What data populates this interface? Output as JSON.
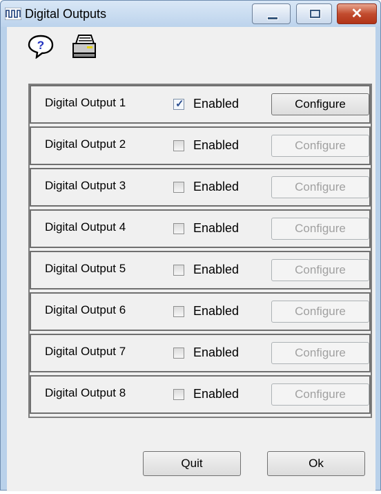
{
  "window": {
    "title": "Digital Outputs",
    "title_icon": "square-wave-icon",
    "controls": {
      "minimize": "minimize",
      "maximize": "maximize",
      "close": "✕"
    }
  },
  "toolbar": {
    "icons": [
      "help-icon",
      "printer-icon"
    ]
  },
  "outputs": [
    {
      "label": "Digital Output 1",
      "enabled_label": "Enabled",
      "enabled": true,
      "configure_label": "Configure",
      "configure_enabled": true
    },
    {
      "label": "Digital Output 2",
      "enabled_label": "Enabled",
      "enabled": false,
      "configure_label": "Configure",
      "configure_enabled": false
    },
    {
      "label": "Digital Output 3",
      "enabled_label": "Enabled",
      "enabled": false,
      "configure_label": "Configure",
      "configure_enabled": false
    },
    {
      "label": "Digital Output 4",
      "enabled_label": "Enabled",
      "enabled": false,
      "configure_label": "Configure",
      "configure_enabled": false
    },
    {
      "label": "Digital Output 5",
      "enabled_label": "Enabled",
      "enabled": false,
      "configure_label": "Configure",
      "configure_enabled": false
    },
    {
      "label": "Digital Output 6",
      "enabled_label": "Enabled",
      "enabled": false,
      "configure_label": "Configure",
      "configure_enabled": false
    },
    {
      "label": "Digital Output 7",
      "enabled_label": "Enabled",
      "enabled": false,
      "configure_label": "Configure",
      "configure_enabled": false
    },
    {
      "label": "Digital Output 8",
      "enabled_label": "Enabled",
      "enabled": false,
      "configure_label": "Configure",
      "configure_enabled": false
    }
  ],
  "footer": {
    "quit_label": "Quit",
    "ok_label": "Ok"
  },
  "colors": {
    "title_bar": "#c5dbf0",
    "close_button": "#c24c2f",
    "disabled_text": "#a0a0a0"
  }
}
